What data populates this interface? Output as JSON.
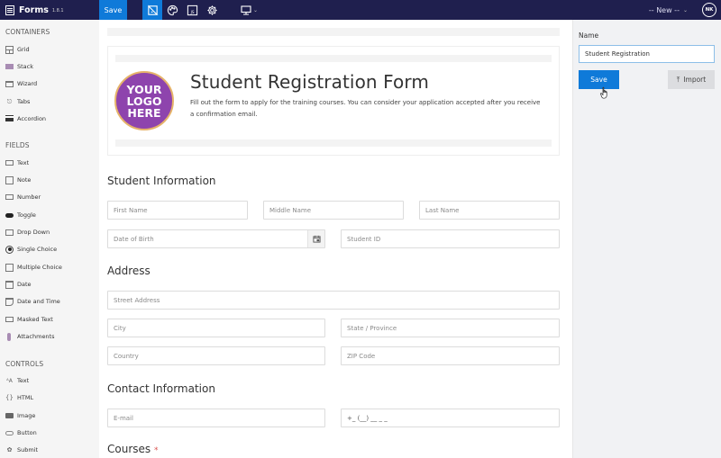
{
  "topbar": {
    "app_title": "Forms",
    "version": "1.8.1",
    "save_label": "Save",
    "tools": [
      {
        "name": "form-designer-icon",
        "active": true
      },
      {
        "name": "palette-icon",
        "active": false
      },
      {
        "name": "js-icon",
        "active": false
      },
      {
        "name": "gear-icon",
        "active": false
      }
    ],
    "device_icon": "desktop-icon",
    "form_select": "-- New --",
    "user_initials": "NK"
  },
  "sidebar": {
    "sections": [
      {
        "title": "CONTAINERS",
        "items": [
          {
            "label": "Grid",
            "icon": "grid-icon"
          },
          {
            "label": "Stack",
            "icon": "stack-icon"
          },
          {
            "label": "Wizard",
            "icon": "wizard-icon"
          },
          {
            "label": "Tabs",
            "icon": "tabs-icon"
          },
          {
            "label": "Accordion",
            "icon": "accordion-icon"
          }
        ]
      },
      {
        "title": "FIELDS",
        "items": [
          {
            "label": "Text",
            "icon": "text-field-icon"
          },
          {
            "label": "Note",
            "icon": "note-icon"
          },
          {
            "label": "Number",
            "icon": "number-icon"
          },
          {
            "label": "Toggle",
            "icon": "toggle-icon"
          },
          {
            "label": "Drop Down",
            "icon": "dropdown-icon"
          },
          {
            "label": "Single Choice",
            "icon": "radio-icon"
          },
          {
            "label": "Multiple Choice",
            "icon": "checkbox-icon"
          },
          {
            "label": "Date",
            "icon": "calendar-icon"
          },
          {
            "label": "Date and Time",
            "icon": "datetime-icon"
          },
          {
            "label": "Masked Text",
            "icon": "masked-text-icon"
          },
          {
            "label": "Attachments",
            "icon": "attachment-icon"
          }
        ]
      },
      {
        "title": "CONTROLS",
        "items": [
          {
            "label": "Text",
            "icon": "text-control-icon"
          },
          {
            "label": "HTML",
            "icon": "html-icon"
          },
          {
            "label": "Image",
            "icon": "image-icon"
          },
          {
            "label": "Button",
            "icon": "button-icon"
          },
          {
            "label": "Submit",
            "icon": "submit-icon"
          }
        ]
      }
    ]
  },
  "form": {
    "logo_lines": [
      "YOUR",
      "LOGO",
      "HERE"
    ],
    "title": "Student Registration Form",
    "description": "Fill out the form to apply for the training courses. You can consider your application accepted after you receive a confirmation email.",
    "sections": {
      "student": {
        "title": "Student Information",
        "first_name": "First Name",
        "middle_name": "Middle Name",
        "last_name": "Last Name",
        "dob": "Date of Birth",
        "student_id": "Student ID"
      },
      "address": {
        "title": "Address",
        "street": "Street Address",
        "city": "City",
        "state": "State / Province",
        "country": "Country",
        "zip": "ZIP Code"
      },
      "contact": {
        "title": "Contact Information",
        "email": "E-mail",
        "phone": "+_ (__) __ _ _"
      },
      "courses": {
        "title": "Courses",
        "required_mark": "*"
      }
    }
  },
  "right_panel": {
    "name_label": "Name",
    "name_value": "Student Registration",
    "save_label": "Save",
    "import_label": "Import"
  },
  "colors": {
    "topbar_bg": "#1f1f4e",
    "accent": "#0f7ad9",
    "logo_purple": "#8e44ad",
    "required": "#d9534f"
  }
}
